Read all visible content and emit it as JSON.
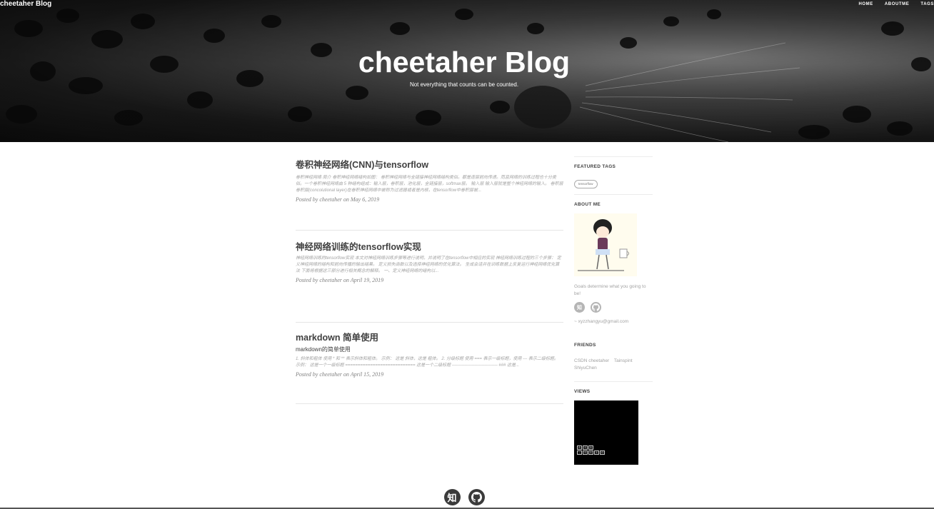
{
  "site": {
    "brand": "cheetaher Blog",
    "title": "cheetaher Blog",
    "subtitle": "Not everything that counts can be counted."
  },
  "nav": [
    {
      "label": "HOME"
    },
    {
      "label": "ABOUTME"
    },
    {
      "label": "TAGS"
    }
  ],
  "posts": [
    {
      "title": "卷积神经网络(CNN)与tensorflow",
      "subtitle": "",
      "excerpt": "卷积神经网络 简介 卷积神经网络结构如图： 卷积神经网络与全链接神经网络结构类似。都是逐层前向传递。而且网络的训练过程也十分类似。一个卷积神经网络由 5 种结构组成：输入层，卷积层，池化层，全链接层，softmax层。 输入层 输入层就是整个神经网络的输入。 卷积层 卷积层(concolutional layer)在卷积神经网络中被称为过滤器或者是内核，在tensorflow中卷积层被...",
      "meta": "Posted by cheetaher on May 6, 2019"
    },
    {
      "title": "神经网络训练的tensorflow实现",
      "subtitle": "",
      "excerpt": "神经网络训练的tensorflow实现 本文对神经网络训练步骤等进行说明，并说明了在tensorflow中相应的实现 神经网络训练过程的三个步骤： 定义神经网络的结构和前向传播的输出结果。 定义损失函数以及选择神经网络的优化算法。 生成会话并在训练数据上反复运行神经网络优化算法 下面将根据这三部分进行相关概念的解释。 一、定义神经网络的结构以...",
      "meta": "Posted by cheetaher on April 19, 2019"
    },
    {
      "title": "markdown 简单使用",
      "subtitle": "markdown的简单使用",
      "excerpt": "1. 斜体和粗体 使用 * 和 ** 表示斜体和粗体。 示例： 这是 斜体，这是 粗体。 2. 分级标题 使用 === 表示一级标题，使用 --- 表示二级标题。 示例： 这是一个一级标题 ============================ 这是一个二级标题 -------------------------------- ### 这是...",
      "meta": "Posted by cheetaher on April 15, 2019"
    }
  ],
  "sidebar": {
    "featured_tags_heading": "FEATURED TAGS",
    "tags": [
      "tensorflow"
    ],
    "about_heading": "ABOUT ME",
    "about_text": "Goals determine what you going to be!",
    "about_icons": [
      {
        "name": "zhihu-icon",
        "glyph": "知"
      },
      {
        "name": "github-icon",
        "glyph": "github"
      }
    ],
    "email": "~ xyzzhangyu@gmail.com",
    "friends_heading": "FRIENDS",
    "friends": [
      "CSDN cheetaher",
      "Tainspint",
      "ShiyuChen"
    ],
    "views_heading": "VIEWS",
    "view_keys": [
      [
        "A",
        "4",
        "A"
      ],
      [
        "-",
        "9",
        "6",
        "4",
        "G"
      ]
    ]
  },
  "footer": {
    "icons": [
      {
        "name": "zhihu-icon",
        "glyph": "知"
      },
      {
        "name": "github-icon",
        "glyph": "github"
      }
    ]
  },
  "colors": {
    "hero_dark": "#111111",
    "text": "#404040",
    "muted": "#a3a3a3",
    "rule": "#e6e6e6"
  }
}
